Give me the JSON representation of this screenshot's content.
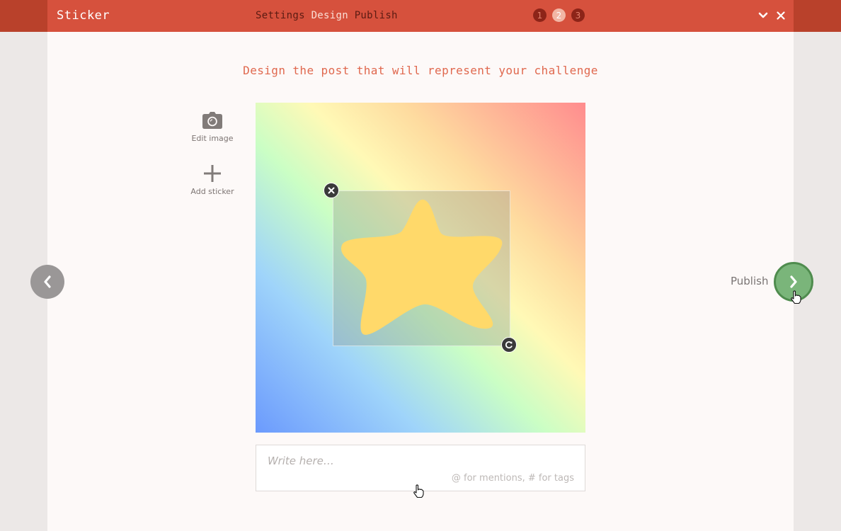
{
  "header": {
    "app_title": "Sticker",
    "steps": [
      {
        "label": "Settings",
        "number": "1",
        "active": false
      },
      {
        "label": "Design",
        "number": "2",
        "active": true
      },
      {
        "label": "Publish",
        "number": "3",
        "active": false
      }
    ],
    "collapse_icon": "chevron-down-icon",
    "close_icon": "close-icon"
  },
  "main": {
    "heading": "Design the post that will represent your challenge",
    "tools": {
      "edit_image_label": "Edit image",
      "add_sticker_label": "Add sticker"
    },
    "canvas": {
      "sticker": "star",
      "remove_icon": "close-icon",
      "rotate_icon": "rotate-icon"
    },
    "caption": {
      "placeholder": "Write here…",
      "value": "",
      "hint": "@ for mentions, # for tags"
    }
  },
  "nav": {
    "back_icon": "chevron-left-icon",
    "next_label": "Publish",
    "next_icon": "chevron-right-icon"
  },
  "colors": {
    "header_bar": "#d6513d",
    "header_outer": "#b9412b",
    "accent_text": "#e0684e",
    "page_bg": "#fdf9f8",
    "next_button": "#7ab57a",
    "star": "#ffd96a"
  }
}
